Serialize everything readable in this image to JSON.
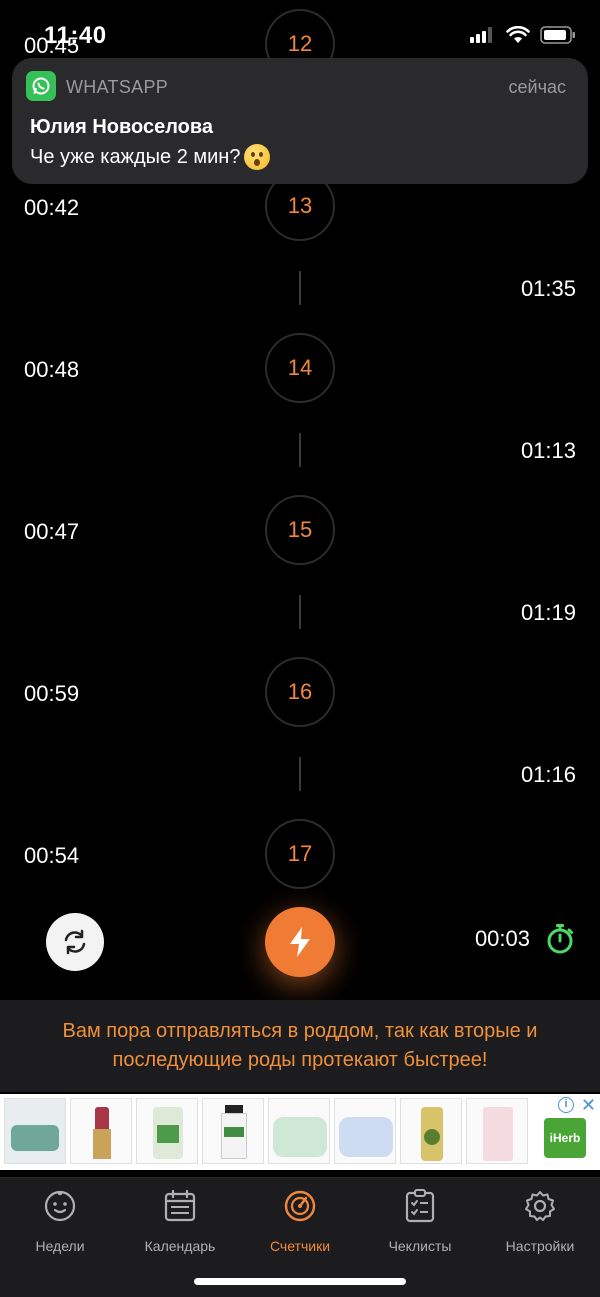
{
  "status_bar": {
    "time": "11:40"
  },
  "notification": {
    "app": "WHATSAPP",
    "time": "сейчас",
    "sender": "Юлия Новоселова",
    "message": "Че уже каждые 2 мин?"
  },
  "contractions": [
    {
      "number": "12",
      "duration": "00:45"
    },
    {
      "number": "13",
      "duration": "00:42",
      "interval_after": "01:35"
    },
    {
      "number": "14",
      "duration": "00:48",
      "interval_after": "01:13"
    },
    {
      "number": "15",
      "duration": "00:47",
      "interval_after": "01:19"
    },
    {
      "number": "16",
      "duration": "00:59",
      "interval_after": "01:16"
    },
    {
      "number": "17",
      "duration": "00:54"
    }
  ],
  "controls": {
    "timer": "00:03"
  },
  "advice": "Вам пора отправляться в роддом, так как вторые и последующие роды протекают быстрее!",
  "ad": {
    "brand": "iHerb"
  },
  "tabs": [
    {
      "label": "Недели",
      "icon": "baby-face-icon"
    },
    {
      "label": "Календарь",
      "icon": "calendar-icon"
    },
    {
      "label": "Счетчики",
      "icon": "counter-icon",
      "active": true
    },
    {
      "label": "Чеклисты",
      "icon": "checklist-icon"
    },
    {
      "label": "Настройки",
      "icon": "gear-icon"
    }
  ],
  "colors": {
    "accent": "#f0873a",
    "timer_icon": "#4cd964",
    "background": "#000000"
  }
}
